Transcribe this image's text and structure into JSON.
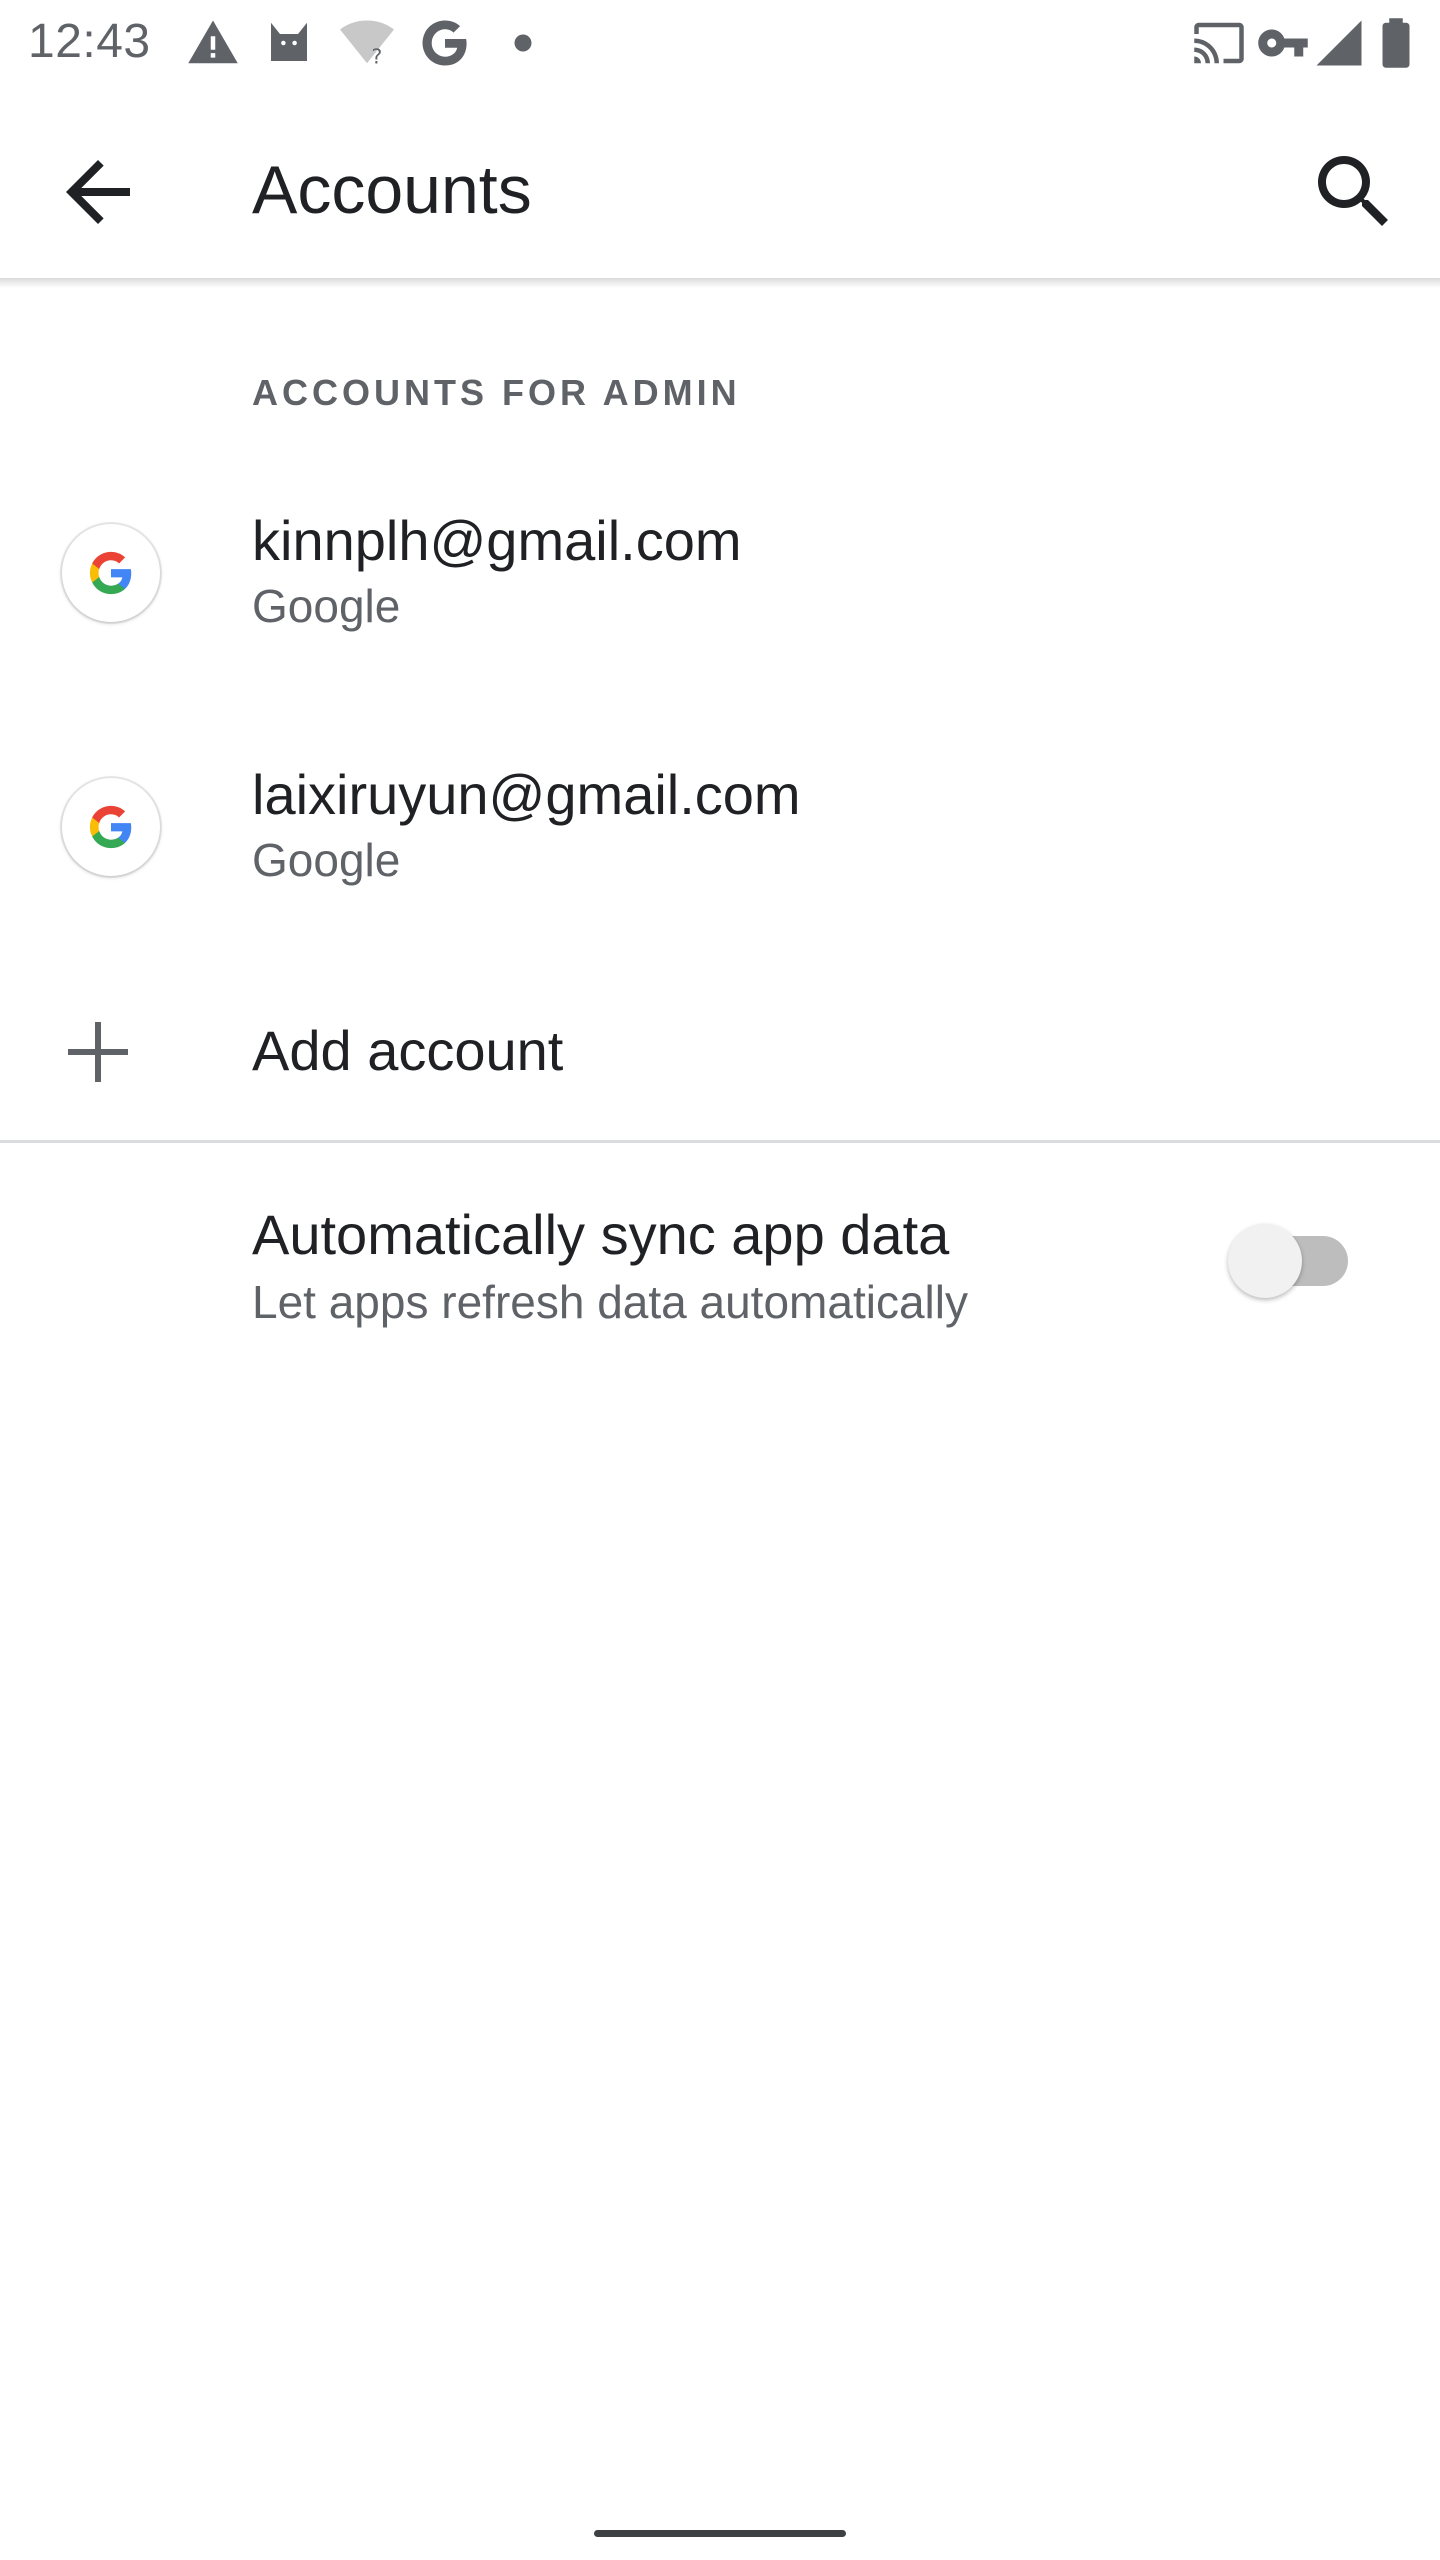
{
  "status_bar": {
    "time": "12:43",
    "left_icons": [
      "warning-icon",
      "cat-icon",
      "wifi-unknown-icon",
      "google-g-icon",
      "dot-icon"
    ],
    "right_icons": [
      "cast-icon",
      "vpn-key-icon",
      "signal-icon",
      "battery-icon"
    ]
  },
  "app_bar": {
    "title": "Accounts",
    "back_icon": "arrow-back-icon",
    "search_icon": "search-icon"
  },
  "section": {
    "header": "ACCOUNTS FOR ADMIN"
  },
  "accounts": [
    {
      "email": "kinnplh@gmail.com",
      "type": "Google",
      "icon": "google-logo-icon"
    },
    {
      "email": "laixiruyun@gmail.com",
      "type": "Google",
      "icon": "google-logo-icon"
    }
  ],
  "add_account": {
    "label": "Add account",
    "icon": "plus-icon"
  },
  "sync": {
    "title": "Automatically sync app data",
    "subtitle": "Let apps refresh data automatically",
    "enabled": false
  },
  "colors": {
    "text_primary": "#202124",
    "text_secondary": "#5f6368",
    "divider": "#dadce0",
    "toggle_off_track": "#bdbdbd",
    "toggle_off_thumb": "#f1f1f1"
  }
}
